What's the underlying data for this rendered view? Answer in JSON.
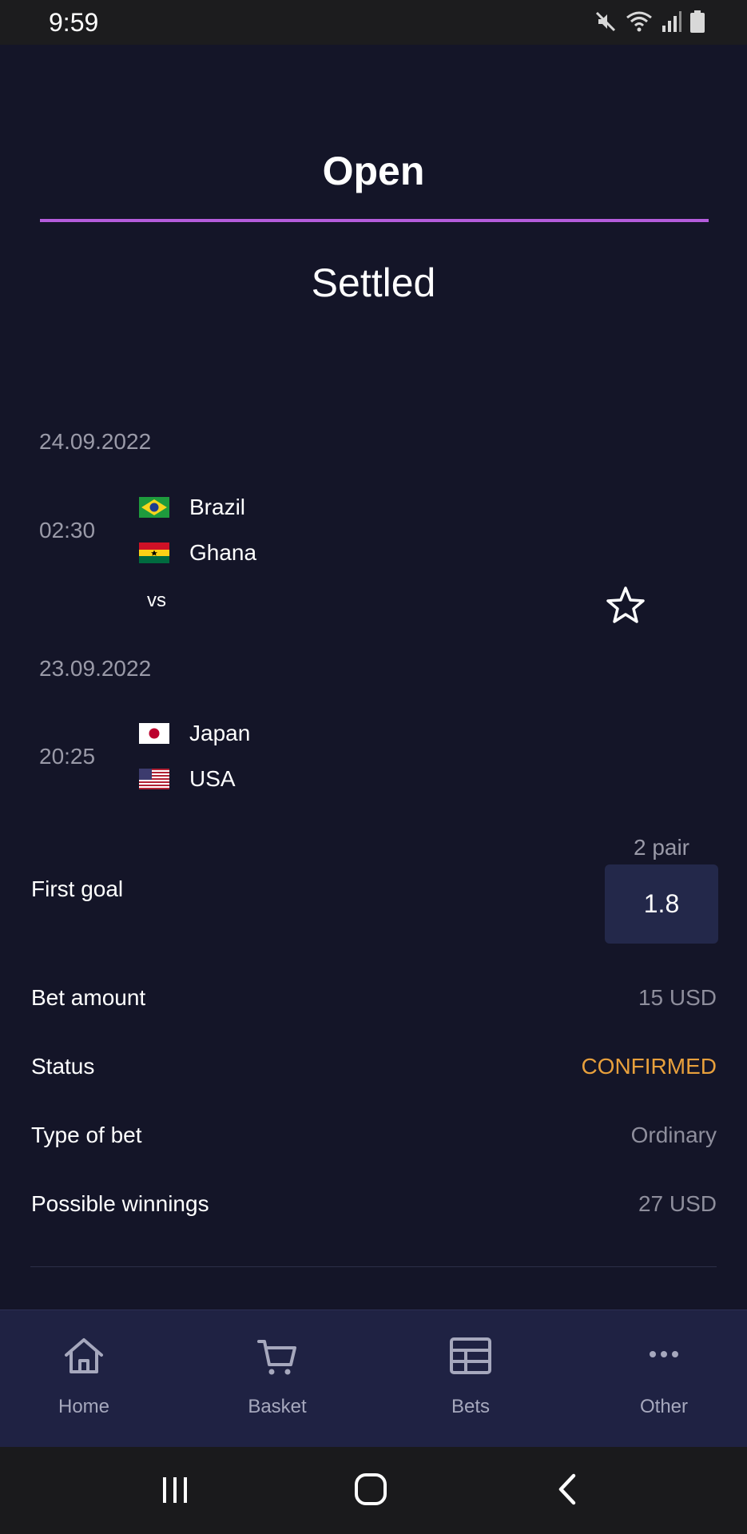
{
  "status_bar": {
    "time": "9:59",
    "icons": [
      "mute-icon",
      "wifi-icon",
      "signal-icon",
      "battery-icon"
    ]
  },
  "tabs": {
    "open_label": "Open",
    "settled_label": "Settled",
    "active": "Open",
    "accent_color": "#b45cdc"
  },
  "matches": [
    {
      "date": "24.09.2022",
      "time": "02:30",
      "team1": "Brazil",
      "team2": "Ghana"
    },
    {
      "date": "23.09.2022",
      "time": "20:25",
      "team1": "Japan",
      "team2": "USA"
    }
  ],
  "vs_label": "vs",
  "bet": {
    "market_label": "First goal",
    "pair_label": "2 pair",
    "odds": "1.8",
    "rows": [
      {
        "label": "Bet amount",
        "value": "15 USD"
      },
      {
        "label": "Status",
        "value": "CONFIRMED"
      },
      {
        "label": "Type of bet",
        "value": "Ordinary"
      },
      {
        "label": "Possible winnings",
        "value": "27 USD"
      }
    ],
    "status_color": "#e8a03c"
  },
  "bottom_nav": {
    "items": [
      {
        "label": "Home",
        "icon": "home-icon"
      },
      {
        "label": "Basket",
        "icon": "cart-icon"
      },
      {
        "label": "Bets",
        "icon": "table-icon"
      },
      {
        "label": "Other",
        "icon": "more-icon"
      }
    ]
  },
  "system_nav": {
    "icons": [
      "recent-apps-icon",
      "home-button-icon",
      "back-icon"
    ]
  }
}
